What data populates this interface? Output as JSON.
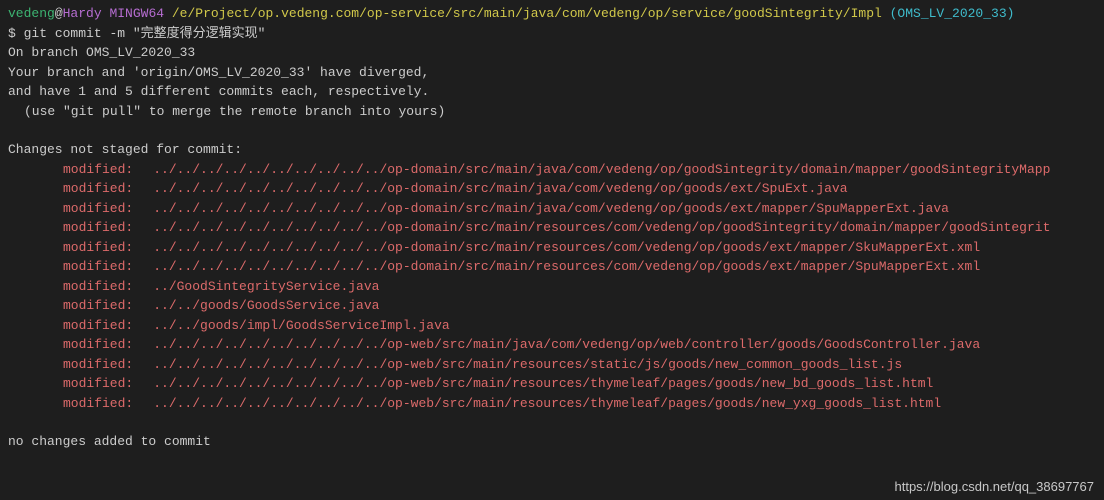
{
  "prompt": {
    "user": "vedeng",
    "at": "@",
    "host": "Hardy",
    "tool": "MINGW64",
    "path": "/e/Project/op.vedeng.com/op-service/src/main/java/com/vedeng/op/service/goodSintegrity/Impl",
    "branch": "(OMS_LV_2020_33)",
    "dollar": "$",
    "command": "git commit -m \"完整度得分逻辑实现\""
  },
  "output": {
    "l1": "On branch OMS_LV_2020_33",
    "l2": "Your branch and 'origin/OMS_LV_2020_33' have diverged,",
    "l3": "and have 1 and 5 different commits each, respectively.",
    "l4": "(use \"git pull\" to merge the remote branch into yours)",
    "l5": "Changes not staged for commit:",
    "l6": "no changes added to commit"
  },
  "changes": [
    {
      "label": "modified:",
      "path": "../../../../../../../../../../op-domain/src/main/java/com/vedeng/op/goodSintegrity/domain/mapper/goodSintegrityMapp"
    },
    {
      "label": "modified:",
      "path": "../../../../../../../../../../op-domain/src/main/java/com/vedeng/op/goods/ext/SpuExt.java"
    },
    {
      "label": "modified:",
      "path": "../../../../../../../../../../op-domain/src/main/java/com/vedeng/op/goods/ext/mapper/SpuMapperExt.java"
    },
    {
      "label": "modified:",
      "path": "../../../../../../../../../../op-domain/src/main/resources/com/vedeng/op/goodSintegrity/domain/mapper/goodSintegrit"
    },
    {
      "label": "modified:",
      "path": "../../../../../../../../../../op-domain/src/main/resources/com/vedeng/op/goods/ext/mapper/SkuMapperExt.xml"
    },
    {
      "label": "modified:",
      "path": "../../../../../../../../../../op-domain/src/main/resources/com/vedeng/op/goods/ext/mapper/SpuMapperExt.xml"
    },
    {
      "label": "modified:",
      "path": "../GoodSintegrityService.java"
    },
    {
      "label": "modified:",
      "path": "../../goods/GoodsService.java"
    },
    {
      "label": "modified:",
      "path": "../../goods/impl/GoodsServiceImpl.java"
    },
    {
      "label": "modified:",
      "path": "../../../../../../../../../../op-web/src/main/java/com/vedeng/op/web/controller/goods/GoodsController.java"
    },
    {
      "label": "modified:",
      "path": "../../../../../../../../../../op-web/src/main/resources/static/js/goods/new_common_goods_list.js"
    },
    {
      "label": "modified:",
      "path": "../../../../../../../../../../op-web/src/main/resources/thymeleaf/pages/goods/new_bd_goods_list.html"
    },
    {
      "label": "modified:",
      "path": "../../../../../../../../../../op-web/src/main/resources/thymeleaf/pages/goods/new_yxg_goods_list.html"
    }
  ],
  "watermark": "https://blog.csdn.net/qq_38697767"
}
